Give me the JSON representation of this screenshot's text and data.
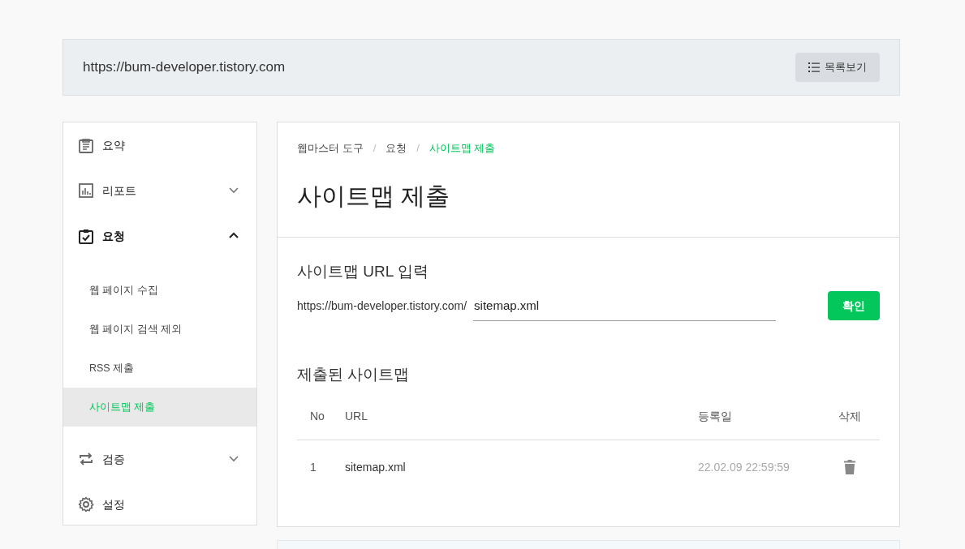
{
  "header": {
    "site_url": "https://bum-developer.tistory.com",
    "list_button": "목록보기"
  },
  "sidebar": {
    "items": [
      {
        "label": "요약",
        "selected": false
      },
      {
        "label": "리포트",
        "selected": false,
        "expanded": false
      },
      {
        "label": "요청",
        "selected": true,
        "expanded": true,
        "children": [
          {
            "label": "웹 페이지 수집",
            "selected": false
          },
          {
            "label": "웹 페이지 검색 제외",
            "selected": false
          },
          {
            "label": "RSS 제출",
            "selected": false
          },
          {
            "label": "사이트맵 제출",
            "selected": true
          }
        ]
      },
      {
        "label": "검증",
        "selected": false,
        "expanded": false
      },
      {
        "label": "설정",
        "selected": false
      }
    ]
  },
  "breadcrumb": [
    {
      "label": "웹마스터 도구",
      "selected": false
    },
    {
      "label": "요청",
      "selected": false
    },
    {
      "label": "사이트맵 제출",
      "selected": true
    }
  ],
  "breadcrumb_separator": "/",
  "page_title": "사이트맵 제출",
  "submit_section": {
    "title": "사이트맵 URL 입력",
    "url_prefix": "https://bum-developer.tistory.com/",
    "value": "sitemap.xml",
    "button": "확인"
  },
  "submitted_section": {
    "title": "제출된 사이트맵",
    "table": {
      "columns": [
        "No",
        "URL",
        "등록일",
        "삭제"
      ],
      "rows": [
        {
          "no": "1",
          "url": "sitemap.xml",
          "date": "22.02.09 22:59:59"
        }
      ]
    }
  }
}
